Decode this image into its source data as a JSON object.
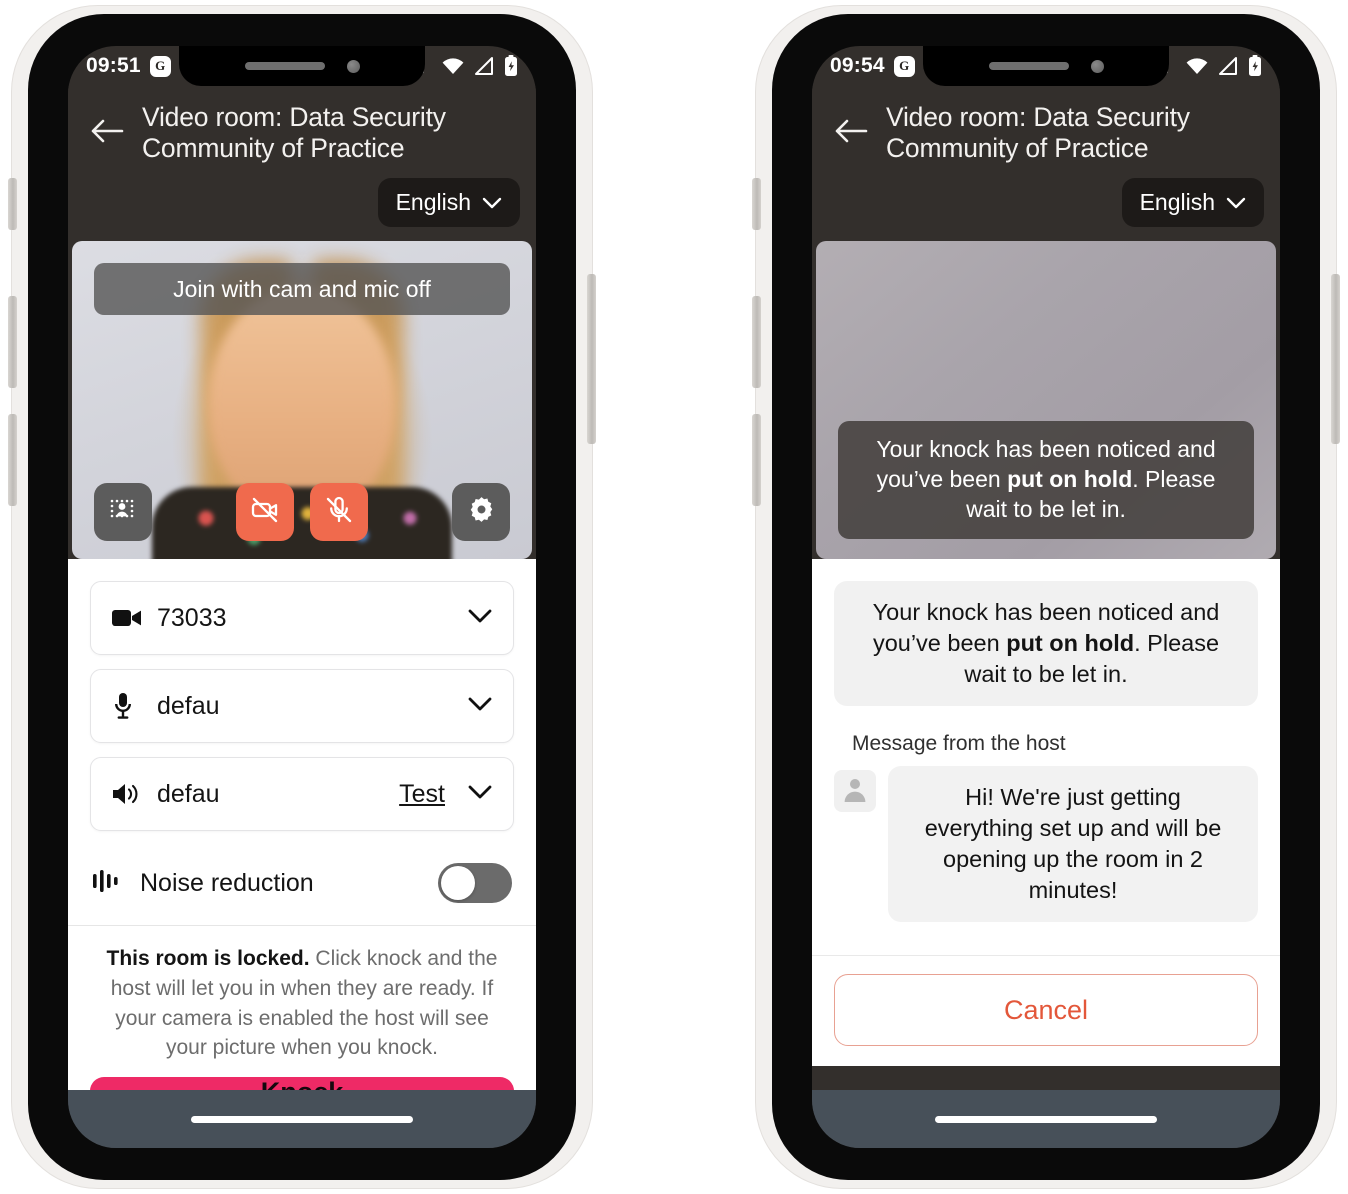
{
  "accent": {
    "knock_pink": "#ee2a66",
    "danger_red": "#f06a4d",
    "cancel_orange": "#e3573a",
    "header_dark": "#332f2c",
    "navbar": "#475059"
  },
  "phones": [
    {
      "id": "phone-left",
      "status_bar": {
        "time": "09:51",
        "app_badge": "G",
        "icons": [
          "phone-wifi-calling-icon",
          "wifi-icon",
          "cell-signal-icon",
          "battery-charging-icon"
        ]
      },
      "header": {
        "back_icon": "back-arrow-icon",
        "title": "Video room: Data Security Community of Practice",
        "language": "English",
        "language_chevron": "chevron-down-icon"
      },
      "video": {
        "join_label": "Join with cam and mic off",
        "controls": [
          {
            "name": "background-effects-button",
            "icon": "person-grid-icon",
            "state": "off"
          },
          {
            "name": "camera-toggle-button",
            "icon": "camera-off-icon",
            "state": "disabled"
          },
          {
            "name": "mic-toggle-button",
            "icon": "mic-off-icon",
            "state": "muted"
          },
          {
            "name": "settings-button",
            "icon": "gear-icon",
            "state": "default"
          }
        ]
      },
      "devices": [
        {
          "icon": "camera-icon",
          "label": "73033",
          "action": null
        },
        {
          "icon": "microphone-icon",
          "label": "defau",
          "action": null
        },
        {
          "icon": "speaker-icon",
          "label": "defau",
          "action": "Test"
        }
      ],
      "noise_reduction": {
        "label": "Noise reduction",
        "icon": "audio-waveform-icon",
        "enabled": false
      },
      "locked_notice": {
        "bold": "This room is locked.",
        "rest": " Click knock and the host will let you in when they are ready. If your camera is enabled the host will see your picture when you knock."
      },
      "primary_button": "Knock"
    },
    {
      "id": "phone-right",
      "status_bar": {
        "time": "09:54",
        "app_badge": "G",
        "icons": [
          "phone-wifi-calling-icon",
          "wifi-icon",
          "cell-signal-icon",
          "battery-charging-icon"
        ]
      },
      "header": {
        "back_icon": "back-arrow-icon",
        "title": "Video room: Data Security Community of Practice",
        "language": "English",
        "language_chevron": "chevron-down-icon"
      },
      "hold_toast": {
        "pre": "Your knock has been noticed and you’ve been ",
        "bold": "put on hold",
        "post": ". Please wait to be let in."
      },
      "notice_bubble": {
        "pre": "Your knock has been noticed and you’ve been ",
        "bold": "put on hold",
        "post": ". Please wait to be let in."
      },
      "host_message": {
        "label": "Message from the host",
        "avatar_icon": "person-avatar-icon",
        "text": "Hi! We're just getting everything set up and will be opening up the room in 2 minutes!"
      },
      "primary_button": "Cancel"
    }
  ]
}
